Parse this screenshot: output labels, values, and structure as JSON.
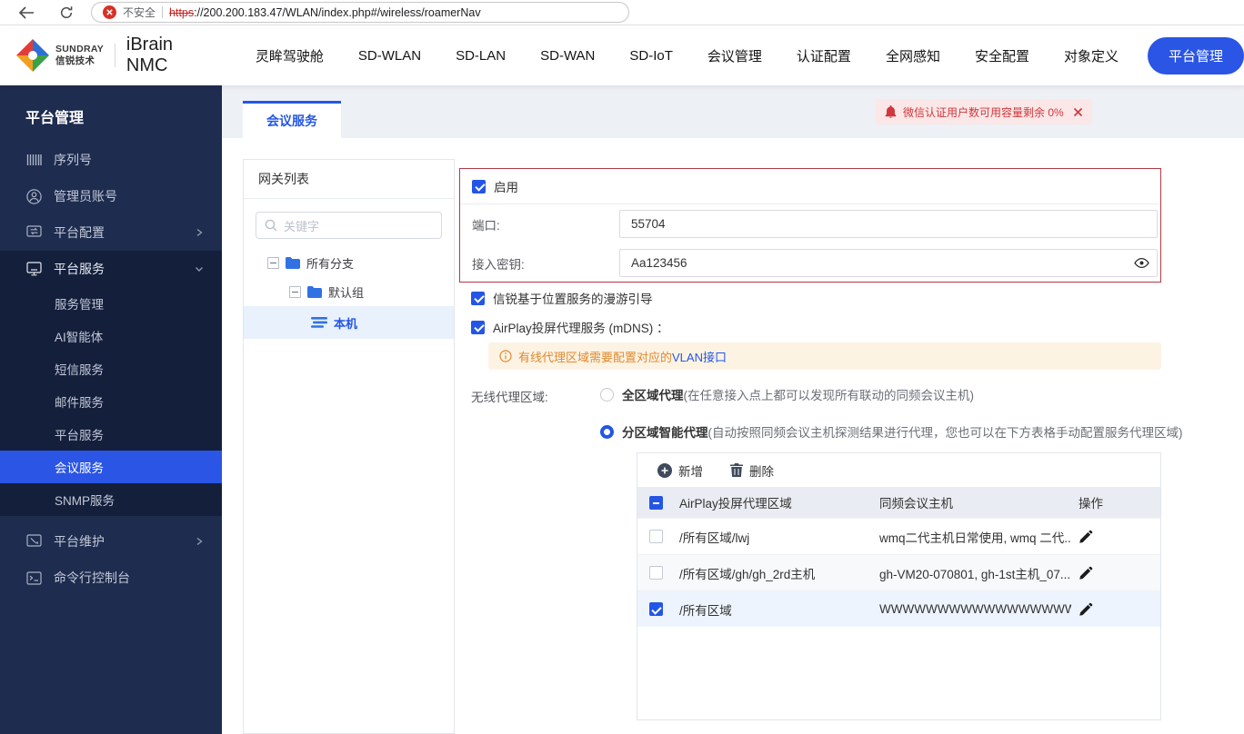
{
  "colors": {
    "accent": "#2a55e5",
    "danger": "#d0383f",
    "warning_text": "#e0892f",
    "sidebar_bg": "#1e2c4f"
  },
  "browser": {
    "security": "不安全",
    "url_scheme": "https",
    "url_rest": "://200.200.183.47/WLAN/index.php#/wireless/roamerNav"
  },
  "topnav": {
    "brand": {
      "name": "SUNDRAY",
      "name_cn": "信锐技术",
      "product": "iBrain NMC"
    },
    "items": [
      "灵眸驾驶舱",
      "SD-WLAN",
      "SD-LAN",
      "SD-WAN",
      "SD-IoT",
      "会议管理",
      "认证配置",
      "全网感知",
      "安全配置",
      "对象定义"
    ],
    "active": "平台管理"
  },
  "sidebar": {
    "title": "平台管理",
    "serial": "序列号",
    "admin": "管理员账号",
    "config": "平台配置",
    "service": "平台服务",
    "sub": [
      "服务管理",
      "AI智能体",
      "短信服务",
      "邮件服务",
      "平台服务",
      "会议服务",
      "SNMP服务"
    ],
    "maintain": "平台维护",
    "console": "命令行控制台"
  },
  "tab": {
    "label": "会议服务"
  },
  "notice": {
    "text": "微信认证用户数可用容量剩余 0%"
  },
  "gateway_panel": {
    "title": "网关列表",
    "search_placeholder": "关键字",
    "node_root": "所有分支",
    "node_group": "默认组",
    "node_leaf": "本机"
  },
  "form": {
    "enable": "启用",
    "port_label": "端口:",
    "port_value": "55704",
    "key_label": "接入密钥:",
    "key_value": "Aa123456",
    "roaming": "信锐基于位置服务的漫游引导",
    "airplay": "AirPlay投屏代理服务 (mDNS) ：",
    "warn_text": "有线代理区域需要配置对应的",
    "warn_link": "VLAN接口",
    "area_label": "无线代理区域:",
    "radio_full": "全区域代理",
    "radio_full_desc": "(在任意接入点上都可以发现所有联动的同频会议主机)",
    "radio_smart": "分区域智能代理",
    "radio_smart_desc": "(自动按照同频会议主机探测结果进行代理，您也可以在下方表格手动配置服务代理区域)"
  },
  "table": {
    "add": "新增",
    "del": "删除",
    "col_region": "AirPlay投屏代理区域",
    "col_host": "同频会议主机",
    "col_action": "操作",
    "rows": [
      {
        "region": "/所有区域/lwj",
        "host": "wmq二代主机日常使用, wmq 二代..."
      },
      {
        "region": "/所有区域/gh/gh_2rd主机",
        "host": "gh-VM20-070801, gh-1st主机_07..."
      },
      {
        "region": "/所有区域",
        "host": "WWWWWWWWWWWWWWWWW"
      }
    ]
  }
}
